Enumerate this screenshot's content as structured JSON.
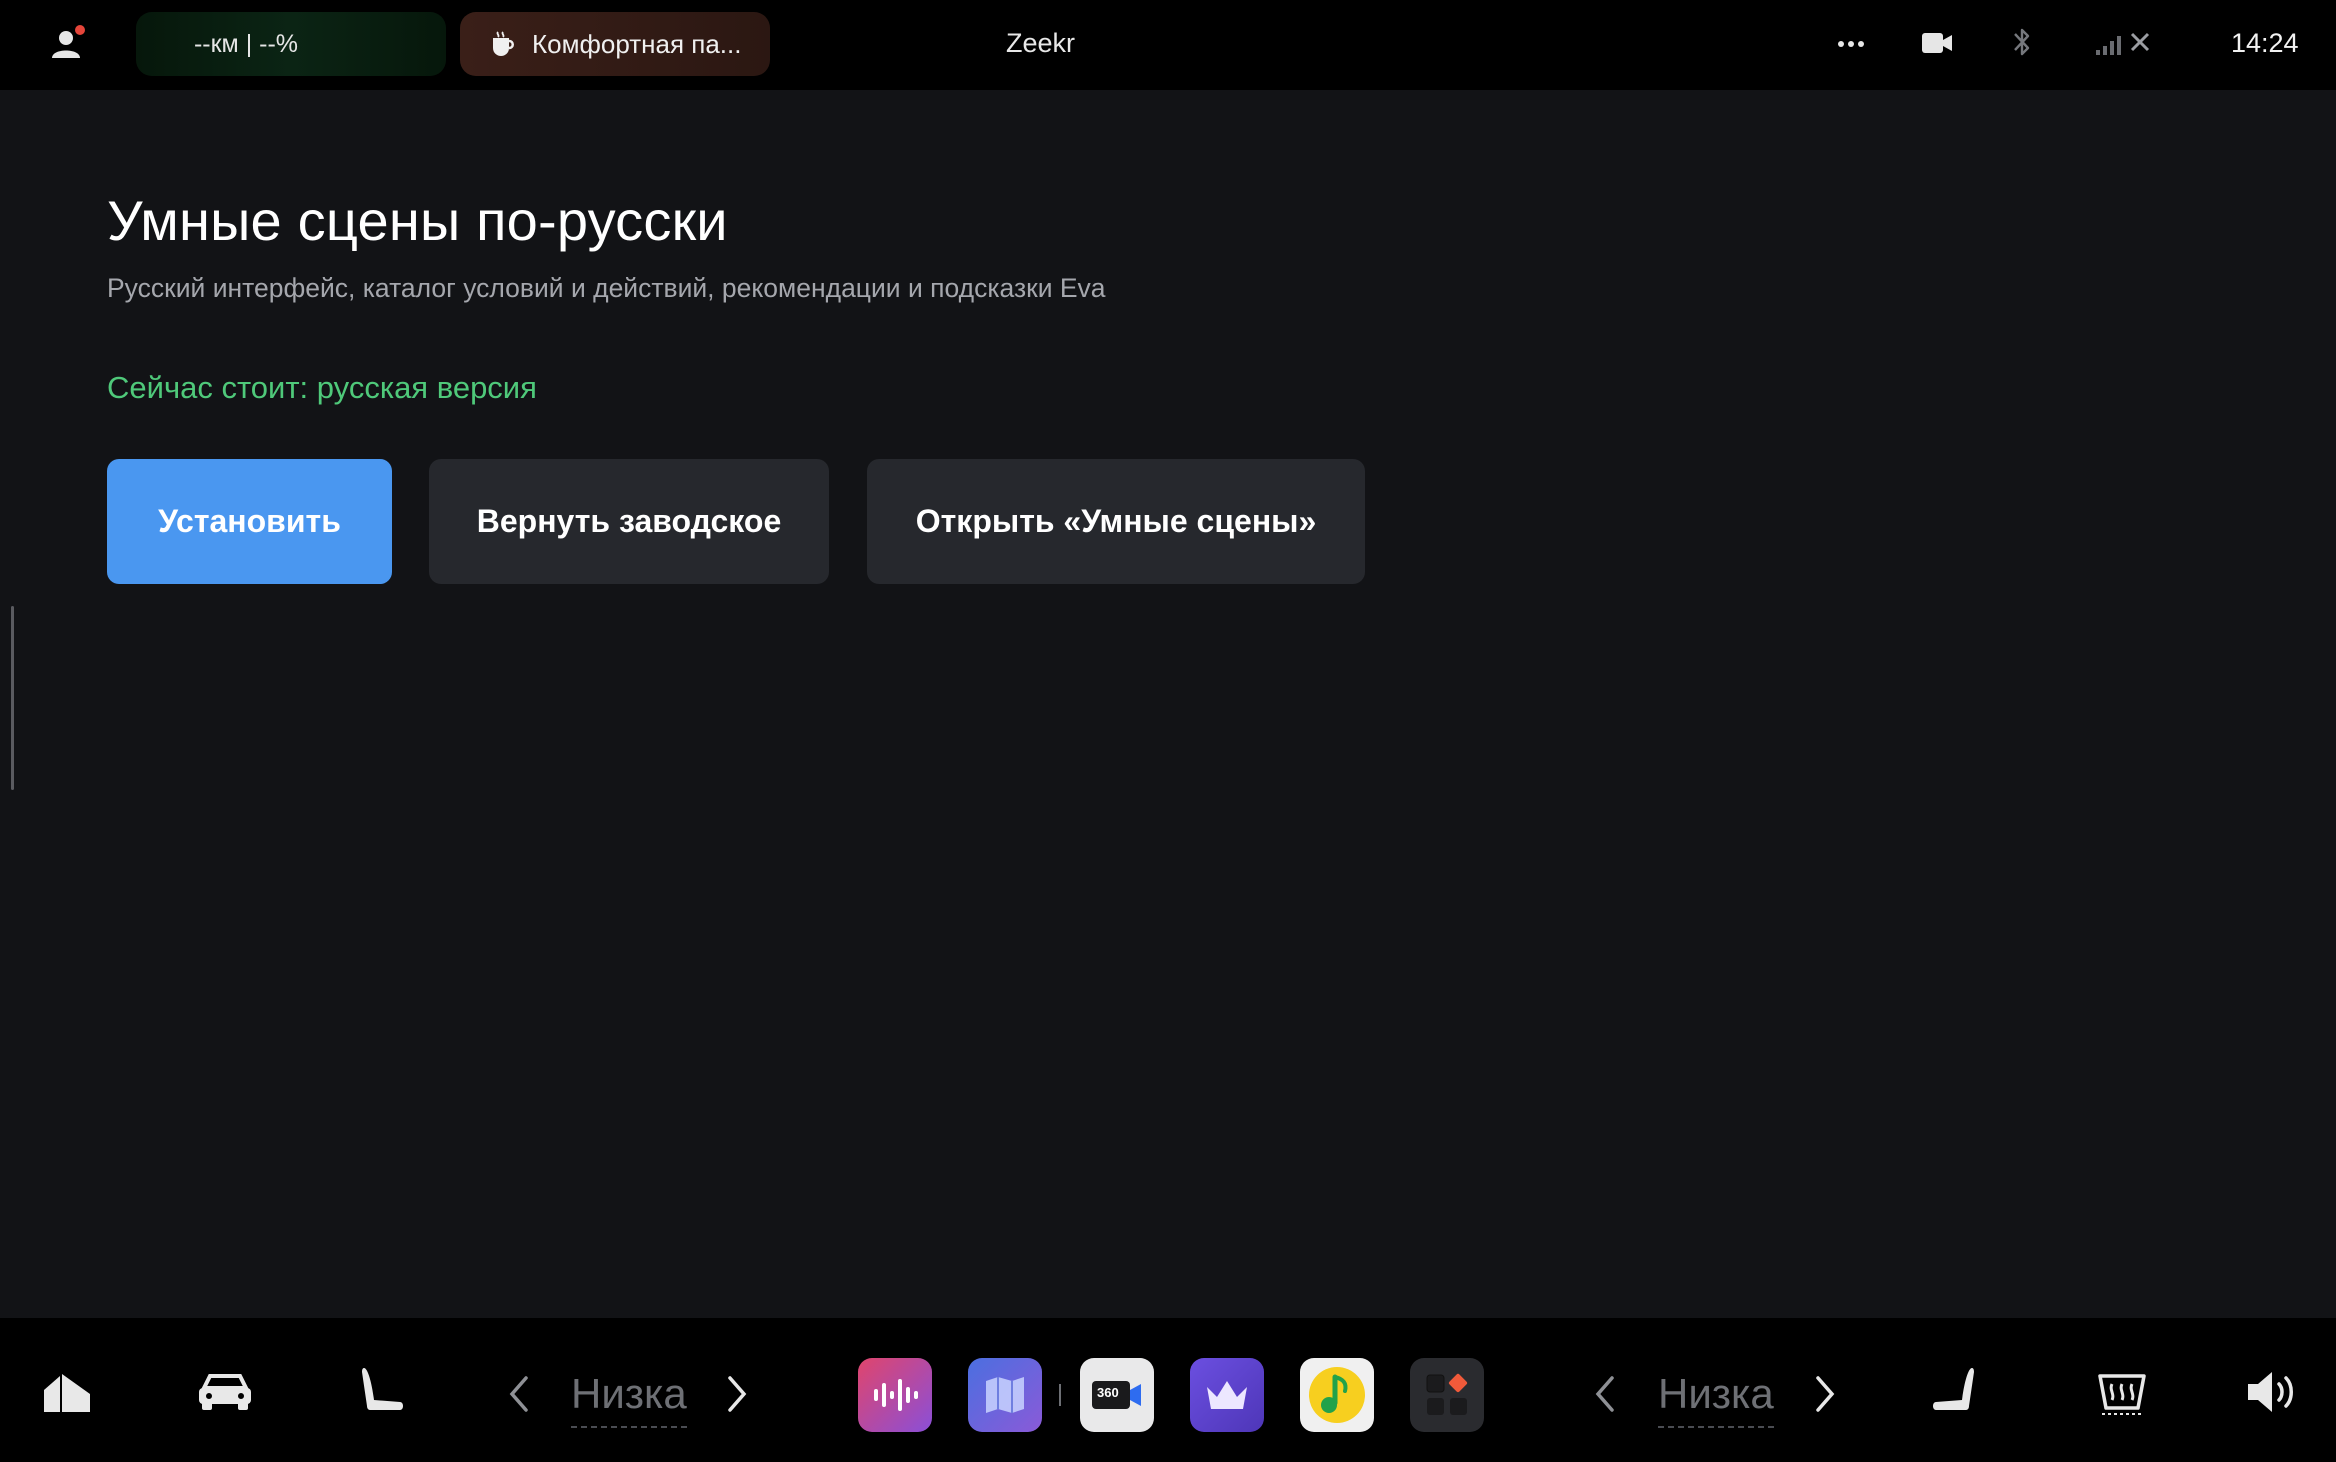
{
  "statusbar": {
    "range_text": "--км | --%",
    "mode_text": "Комфортная па...",
    "brand": "Zeekr",
    "time": "14:24",
    "icons": [
      "user-icon",
      "more-icon",
      "dashcam-icon",
      "bluetooth-icon",
      "signal-icon"
    ]
  },
  "main": {
    "title": "Умные сцены по-русски",
    "subtitle": "Русский интерфейс, каталог условий и действий, рекомендации и подсказки Eva",
    "status": "Сейчас стоит: русская версия",
    "buttons": {
      "install": "Установить",
      "restore": "Вернуть заводское",
      "open": "Открыть «Умные сцены»"
    }
  },
  "dock": {
    "left_temp": "Низка",
    "right_temp": "Низка",
    "apps": [
      "voice-app",
      "maps-app",
      "camera-360-app",
      "crown-app",
      "music-app",
      "app-launcher"
    ],
    "camera_label": "360",
    "colors": {
      "accent": "#4a97f0",
      "status": "#4fc97a"
    }
  }
}
